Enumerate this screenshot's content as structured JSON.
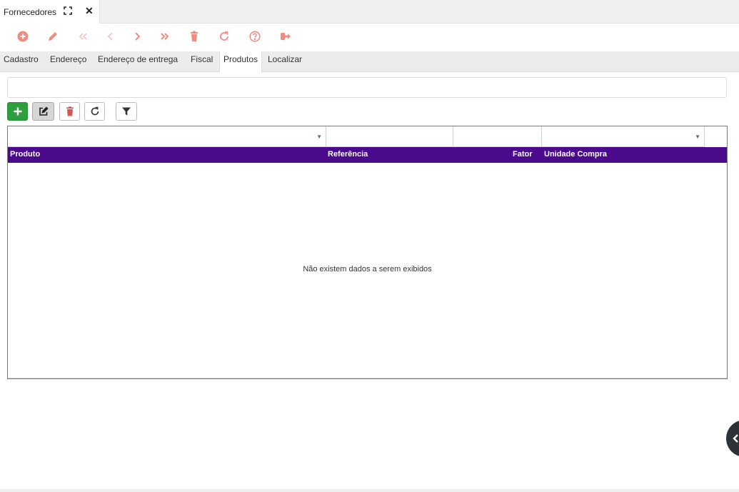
{
  "window_tab": {
    "title": "Fornecedores",
    "maximize_icon": "expand-icon",
    "close_label": "✕"
  },
  "toolbar": {
    "icon_color": "#f08c80",
    "buttons": [
      {
        "name": "new-record-button",
        "icon": "plus-circle-icon"
      },
      {
        "name": "edit-button",
        "icon": "pencil-icon"
      },
      {
        "name": "first-record-button",
        "icon": "double-chevron-left-icon"
      },
      {
        "name": "previous-record-button",
        "icon": "chevron-left-icon"
      },
      {
        "name": "next-record-button",
        "icon": "chevron-right-icon"
      },
      {
        "name": "last-record-button",
        "icon": "double-chevron-right-icon"
      },
      {
        "name": "delete-button",
        "icon": "trash-icon"
      },
      {
        "name": "refresh-button",
        "icon": "refresh-icon"
      },
      {
        "name": "help-button",
        "icon": "question-circle-icon"
      },
      {
        "name": "exit-button",
        "icon": "sign-out-icon"
      }
    ]
  },
  "form_tabs": [
    {
      "label": "Cadastro"
    },
    {
      "label": "Endereço"
    },
    {
      "label": "Endereço de entrega"
    },
    {
      "label": "Fiscal"
    },
    {
      "label": "Produtos",
      "active": true
    },
    {
      "label": "Localizar"
    }
  ],
  "grid_actions": {
    "add_color": "#2e9e3e",
    "delete_color": "#d9534f"
  },
  "grid": {
    "header_color": "#4b0a8c",
    "columns": [
      {
        "label": "Produto"
      },
      {
        "label": "Referência"
      },
      {
        "label": "Fator"
      },
      {
        "label": "Unidade Compra"
      }
    ],
    "empty_message": "Não existem dados a serem exibidos"
  }
}
